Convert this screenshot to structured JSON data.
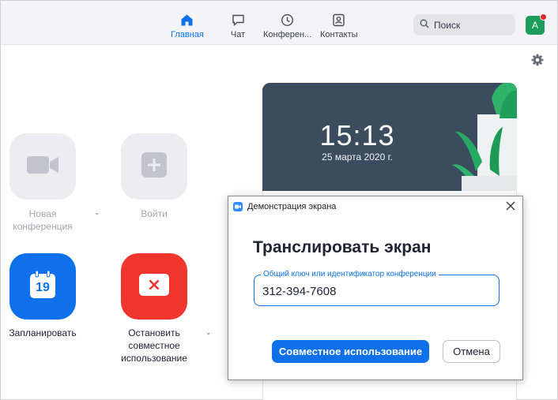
{
  "nav": {
    "items": [
      {
        "label": "Главная",
        "icon": "home-icon",
        "active": true
      },
      {
        "label": "Чат",
        "icon": "chat-icon",
        "active": false
      },
      {
        "label": "Конферен...",
        "icon": "clock-icon",
        "active": false
      },
      {
        "label": "Контакты",
        "icon": "contacts-icon",
        "active": false
      }
    ]
  },
  "search": {
    "placeholder": "Поиск"
  },
  "avatar": {
    "initial": "A",
    "has_notification": true
  },
  "actions": {
    "new_meeting": {
      "label_line1": "Новая",
      "label_line2": "конференция",
      "enabled": false
    },
    "join": {
      "label": "Войти",
      "enabled": false
    },
    "schedule": {
      "label": "Запланировать",
      "calendar_day": "19"
    },
    "stop_share": {
      "label_line1": "Остановить",
      "label_line2": "совместное",
      "label_line3": "использование"
    }
  },
  "clock": {
    "time": "15:13",
    "date": "25 марта 2020 г."
  },
  "dialog": {
    "title": "Демонстрация экрана",
    "heading": "Транслировать экран",
    "field_label": "Общий ключ или идентификатор конференции",
    "field_value": "312-394-7608",
    "primary_button": "Совместное использование",
    "secondary_button": "Отмена"
  },
  "colors": {
    "accent": "#0e71eb",
    "danger": "#f0352e",
    "disabled_tile": "#ececf1"
  }
}
